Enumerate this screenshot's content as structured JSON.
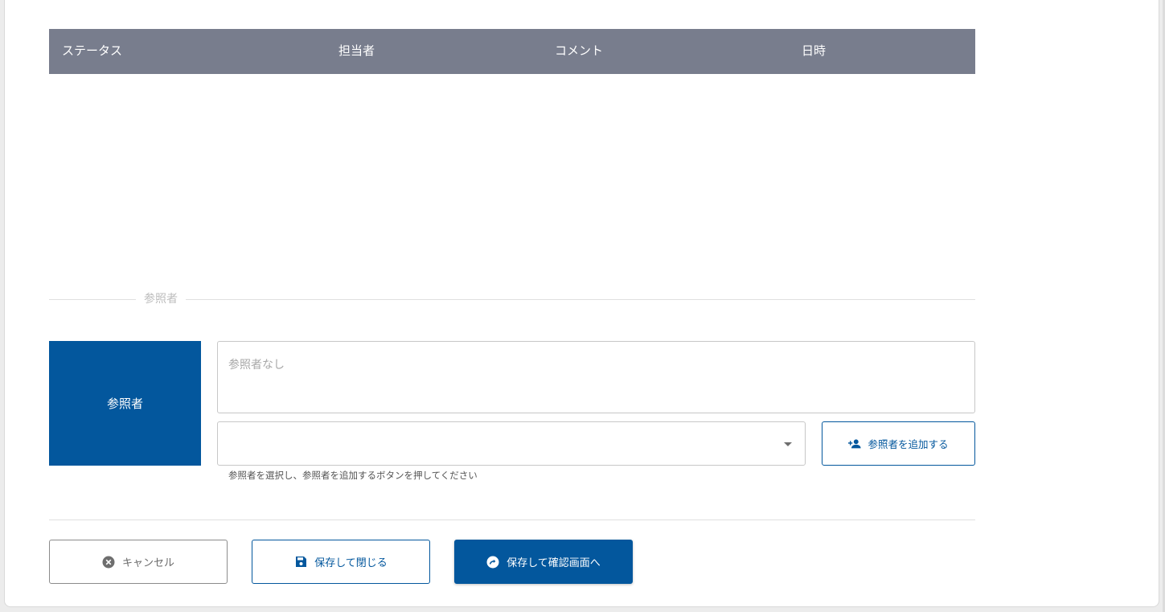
{
  "history_table": {
    "columns": [
      "ステータス",
      "担当者",
      "コメント",
      "日時"
    ]
  },
  "reference_section": {
    "title": "参照者",
    "label": "参照者",
    "current_value": "参照者なし",
    "select_value": "",
    "helper_text": "参照者を選択し、参照者を追加するボタンを押してください",
    "add_button": "参照者を追加する"
  },
  "actions": {
    "cancel": "キャンセル",
    "save_close": "保存して閉じる",
    "save_confirm": "保存して確認画面へ"
  },
  "icons": {
    "add_person": "person-add-icon",
    "cancel": "cancel-circle-icon",
    "save": "floppy-disk-icon",
    "forward": "arrow-right-circle-icon"
  },
  "colors": {
    "primary": "#03579d",
    "table_header": "#787d8d"
  }
}
